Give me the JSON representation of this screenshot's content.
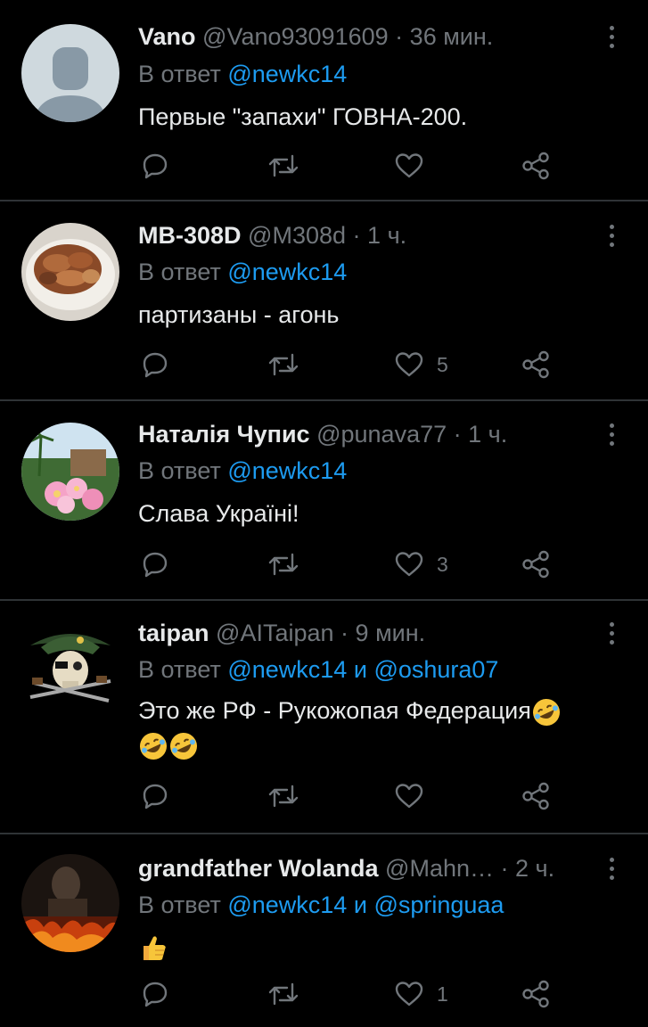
{
  "tweets": [
    {
      "name": "Vano",
      "handle": "@Vano93091609",
      "time": "36 мин.",
      "reply_prefix": "В ответ",
      "reply_to": "@newkc14",
      "reply_join": "",
      "reply_to2": "",
      "text": "Первые \"запахи\" ГОВНА-200.",
      "text2": "",
      "likes": ""
    },
    {
      "name": "MB-308D",
      "handle": "@M308d",
      "time": "1 ч.",
      "reply_prefix": "В ответ",
      "reply_to": "@newkc14",
      "reply_join": "",
      "reply_to2": "",
      "text": "партизаны - агонь",
      "text2": "",
      "likes": "5"
    },
    {
      "name": "Наталія Чупис",
      "handle": "@punava77",
      "time": "1 ч.",
      "reply_prefix": "В ответ",
      "reply_to": "@newkc14",
      "reply_join": "",
      "reply_to2": "",
      "text": "Слава Україні!",
      "text2": "",
      "likes": "3"
    },
    {
      "name": "taipan",
      "handle": "@AITaipan",
      "time": "9 мин.",
      "reply_prefix": "В ответ",
      "reply_to": "@newkc14",
      "reply_join": "и",
      "reply_to2": "@oshura07",
      "text": "Это же РФ - Рукожопая Федерация",
      "text2": "",
      "likes": ""
    },
    {
      "name": "grandfather Wolanda",
      "handle": "@Mahn…",
      "time": "2 ч.",
      "reply_prefix": "В ответ",
      "reply_to": "@newkc14",
      "reply_join": "и",
      "reply_to2": "@springuaa",
      "text": "",
      "text2": "",
      "likes": "1"
    }
  ],
  "icons": {
    "reply": "comment-bubble-icon",
    "retweet": "retweet-icon",
    "like": "heart-icon",
    "share": "share-icon",
    "menu": "more-vertical-icon"
  },
  "colors": {
    "background": "#000000",
    "text": "#e7e9ea",
    "secondary": "#71767b",
    "link": "#1d9bf0",
    "separator": "#2f3336"
  }
}
